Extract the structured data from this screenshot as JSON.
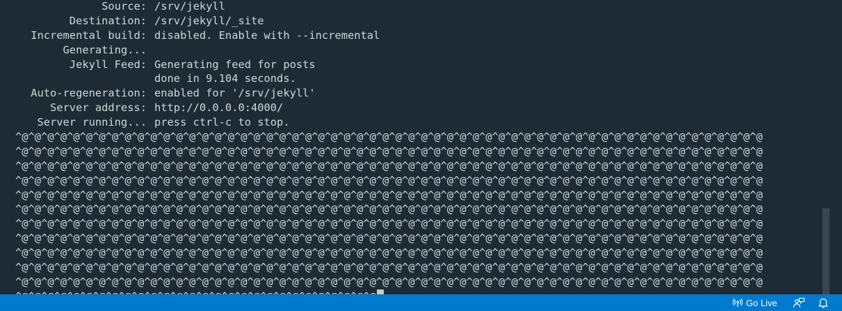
{
  "terminal": {
    "lines": [
      {
        "label": "Source:",
        "value": "/srv/jekyll"
      },
      {
        "label": "Destination:",
        "value": "/srv/jekyll/_site"
      },
      {
        "label": "Incremental build:",
        "value": "disabled. Enable with --incremental"
      },
      {
        "label": "Generating...",
        "value": ""
      },
      {
        "label": "Jekyll Feed:",
        "value": "Generating feed for posts"
      },
      {
        "label": "",
        "value": "done in 9.104 seconds."
      },
      {
        "label": "Auto-regeneration:",
        "value": "enabled for '/srv/jekyll'"
      },
      {
        "label": "Server address:",
        "value": "http://0.0.0.0:4000/"
      },
      {
        "label": "Server running...",
        "value": "press ctrl-c to stop."
      }
    ],
    "control_lines": [
      "^@^@^@^@^@^@^@^@^@^@^@^@^@^@^@^@^@^@^@^@^@^@^@^@^@^@^@^@^@^@^@^@^@^@^@^@^@^@^@^@^@^@^@^@^@^@^@^@^@^@^@^@^@^@^@^@^@^@",
      "^@^@^@^@^@^@^@^@^@^@^@^@^@^@^@^@^@^@^@^@^@^@^@^@^@^@^@^@^@^@^@^@^@^@^@^@^@^@^@^@^@^@^@^@^@^@^@^@^@^@^@^@^@^@^@^@^@^@",
      "^@^@^@^@^@^@^@^@^@^@^@^@^@^@^@^@^@^@^@^@^@^@^@^@^@^@^@^@^@^@^@^@^@^@^@^@^@^@^@^@^@^@^@^@^@^@^@^@^@^@^@^@^@^@^@^@^@^@",
      "^@^@^@^@^@^@^@^@^@^@^@^@^@^@^@^@^@^@^@^@^@^@^@^@^@^@^@^@^@^@^@^@^@^@^@^@^@^@^@^@^@^@^@^@^@^@^@^@^@^@^@^@^@^@^@^@^@^@",
      "^@^@^@^@^@^@^@^@^@^@^@^@^@^@^@^@^@^@^@^@^@^@^@^@^@^@^@^@^@^@^@^@^@^@^@^@^@^@^@^@^@^@^@^@^@^@^@^@^@^@^@^@^@^@^@^@^@^@",
      "^@^@^@^@^@^@^@^@^@^@^@^@^@^@^@^@^@^@^@^@^@^@^@^@^@^@^@^@^@^@^@^@^@^@^@^@^@^@^@^@^@^@^@^@^@^@^@^@^@^@^@^@^@^@^@^@^@^@",
      "^@^@^@^@^@^@^@^@^@^@^@^@^@^@^@^@^@^@^@^@^@^@^@^@^@^@^@^@^@^@^@^@^@^@^@^@^@^@^@^@^@^@^@^@^@^@^@^@^@^@^@^@^@^@^@^@^@^@",
      "^@^@^@^@^@^@^@^@^@^@^@^@^@^@^@^@^@^@^@^@^@^@^@^@^@^@^@^@^@^@^@^@^@^@^@^@^@^@^@^@^@^@^@^@^@^@^@^@^@^@^@^@^@^@^@^@^@^@",
      "^@^@^@^@^@^@^@^@^@^@^@^@^@^@^@^@^@^@^@^@^@^@^@^@^@^@^@^@^@^@^@^@^@^@^@^@^@^@^@^@^@^@^@^@^@^@^@^@^@^@^@^@^@^@^@^@^@^@",
      "^@^@^@^@^@^@^@^@^@^@^@^@^@^@^@^@^@^@^@^@^@^@^@^@^@^@^@^@^@^@^@^@^@^@^@^@^@^@^@^@^@^@^@^@^@^@^@^@^@^@^@^@^@^@^@^@^@^@",
      "^@^@^@^@^@^@^@^@^@^@^@^@^@^@^@^@^@^@^@^@^@^@^@^@^@^@^@^@^@^@^@^@^@^@^@^@^@^@^@^@^@^@^@^@^@^@^@^@^@^@^@^@^@^@^@^@^@^@"
    ],
    "last_line": "^@^@^@^@^@^@^@^@^@^@^@^@^@^@^@^@^@^@^@^@^@^@^@^@^@^@^@^@"
  },
  "statusbar": {
    "go_live_label": "Go Live",
    "go_live_icon": "broadcast-icon",
    "feedback_icon": "feedback-icon",
    "bell_icon": "bell-icon"
  },
  "colors": {
    "terminal_bg": "#1e2b34",
    "terminal_fg": "#cfd8dc",
    "statusbar_bg": "#007acc"
  }
}
